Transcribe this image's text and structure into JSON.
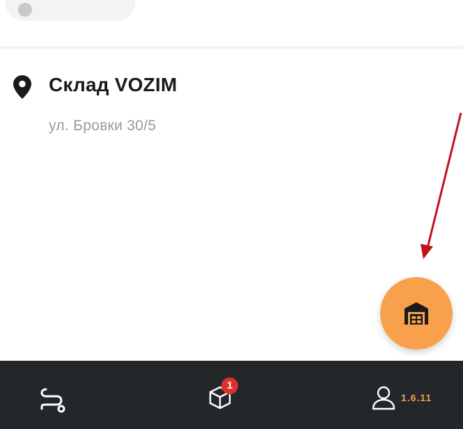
{
  "warehouse": {
    "title": "Склад VOZIM",
    "address": "ул. Бровки 30/5",
    "pin_icon": "location-pin-icon"
  },
  "fab": {
    "icon": "warehouse-icon",
    "color": "#f9a04d"
  },
  "bottom_nav": {
    "background": "#24272a",
    "routes_icon": "route-icon",
    "orders_icon": "package-icon",
    "orders_badge": "1",
    "profile_icon": "user-icon",
    "version": "1.6.11"
  },
  "annotation": {
    "arrow_color": "#c0121a"
  }
}
